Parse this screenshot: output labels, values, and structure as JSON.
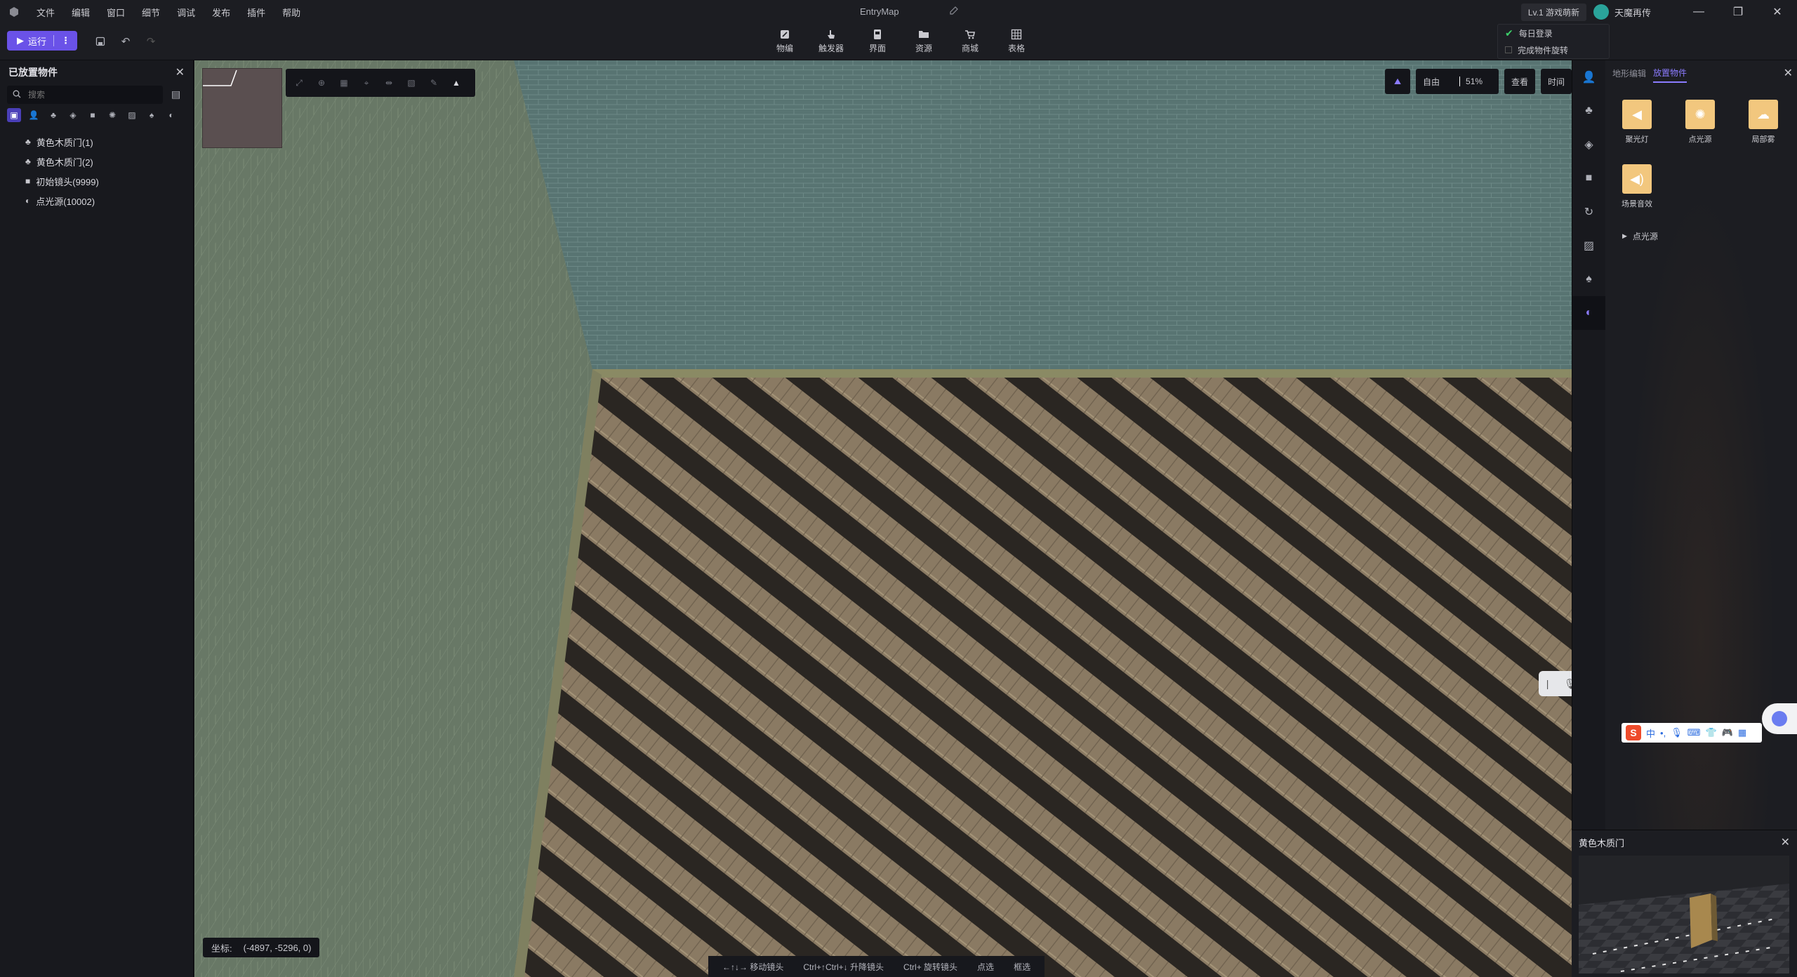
{
  "menubar": {
    "menus": [
      "文件",
      "编辑",
      "窗口",
      "细节",
      "调试",
      "发布",
      "插件",
      "帮助"
    ],
    "title": "EntryMap",
    "level": "Lv.1 游戏萌新",
    "username": "天魔再传"
  },
  "toolbar": {
    "run_label": "运行",
    "top_tools": [
      "物编",
      "触发器",
      "界面",
      "资源",
      "商城",
      "表格"
    ]
  },
  "daily_popup": {
    "items": [
      "每日登录",
      "完成物件旋转"
    ]
  },
  "left_panel": {
    "title": "已放置物件",
    "search_placeholder": "搜索",
    "tree": [
      {
        "icon": "tree-icon",
        "label": "黄色木质门(1)"
      },
      {
        "icon": "tree-icon",
        "label": "黄色木质门(2)"
      },
      {
        "icon": "camera-icon",
        "label": "初始镜头(9999)"
      },
      {
        "icon": "light-icon",
        "label": "点光源(10002)"
      }
    ]
  },
  "viewport": {
    "camera_mode": "自由",
    "zoom": "51%",
    "view_label": "查看",
    "time_label": "时间",
    "coord_label": "坐标:",
    "coord_value": "(-4897, -5296, 0)",
    "hints": [
      "←↑↓→ 移动镜头",
      "Ctrl+↑Ctrl+↓ 升降镜头",
      "Ctrl+ 旋转镜头",
      "点选",
      "框选"
    ]
  },
  "right_panel": {
    "tabs": [
      "地形编辑",
      "放置物件"
    ],
    "active_tab": 1,
    "assets": [
      "聚光灯",
      "点光源",
      "局部雾",
      "场景音效"
    ],
    "group": "点光源"
  },
  "preview": {
    "title": "黄色木质门"
  },
  "colors": {
    "accent": "#6a52e8",
    "asset_thumb": "#f2c77e"
  }
}
